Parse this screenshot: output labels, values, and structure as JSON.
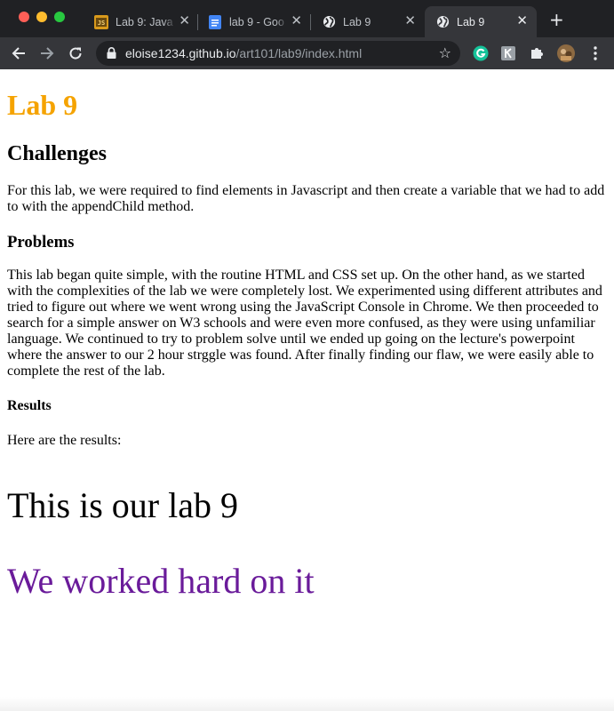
{
  "browser": {
    "tabs": [
      {
        "label": "Lab 9: Java",
        "favicon": "code-site-icon",
        "active": false
      },
      {
        "label": "lab 9 - Goo",
        "favicon": "google-docs-icon",
        "active": false
      },
      {
        "label": "Lab 9",
        "favicon": "globe-icon",
        "active": false
      },
      {
        "label": "Lab 9",
        "favicon": "globe-icon",
        "active": true
      }
    ],
    "url_host": "eloise1234.github.io",
    "url_path": "/art101/lab9/index.html",
    "colors": {
      "tabbar": "#202124",
      "toolbar": "#35363a",
      "active_tab": "#35363a",
      "grammarly": "#15c39a"
    }
  },
  "page": {
    "title": "Lab 9",
    "challenges_heading": "Challenges",
    "challenges_text": "For this lab, we were required to find elements in Javascript and then create a variable that we had to add to with the appendChild method.",
    "problems_heading": "Problems",
    "problems_text": "This lab began quite simple, with the routine HTML and CSS set up. On the other hand, as we started with the complexities of the lab we were completely lost. We experimented using different attributes and tried to figure out where we went wrong using the JavaScript Console in Chrome. We then proceeded to search for a simple answer on W3 schools and were even more confused, as they were using unfamiliar language. We continued to try to problem solve until we ended up going on the lecture's powerpoint where the answer to our 2 hour strggle was found. After finally finding our flaw, we were easily able to complete the rest of the lab.",
    "results_heading": "Results",
    "results_text": "Here are the results:",
    "output_line1": "This is our lab 9",
    "output_line2": "We worked hard on it",
    "colors": {
      "title": "#f5a300",
      "output_line2": "#6a1b9a"
    }
  }
}
